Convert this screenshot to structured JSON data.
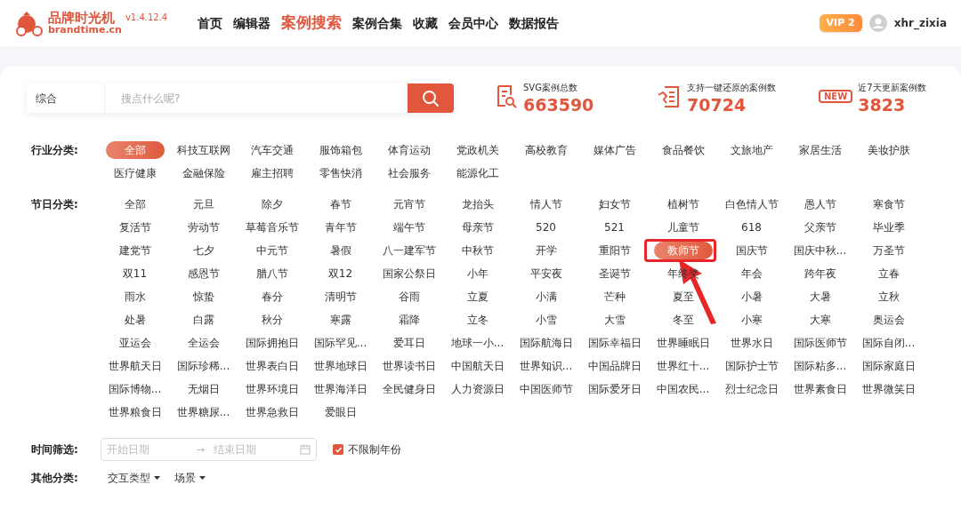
{
  "header": {
    "logo": {
      "name": "品牌时光机",
      "domain": "brandtime.cn"
    },
    "version": "v1.4.12.4",
    "nav": [
      {
        "label": "首页",
        "selected": false
      },
      {
        "label": "编辑器",
        "selected": false
      },
      {
        "label": "案例搜索",
        "selected": true
      },
      {
        "label": "案例合集",
        "selected": false
      },
      {
        "label": "收藏",
        "selected": false
      },
      {
        "label": "会员中心",
        "selected": false
      },
      {
        "label": "数据报告",
        "selected": false
      }
    ],
    "vip_badge": "VIP 2",
    "username": "xhr_zixia"
  },
  "search": {
    "scope": "综合",
    "placeholder": "搜点什么呢?"
  },
  "stats": [
    {
      "kind": "doc",
      "label": "SVG案例总数",
      "value": "663590"
    },
    {
      "kind": "restore",
      "label": "支持一键还原的案例数",
      "value": "70724"
    },
    {
      "kind": "new",
      "label": "近7天更新案例数",
      "value": "3823",
      "icon_text": "NEW"
    }
  ],
  "industry": {
    "label": "行业分类:",
    "items": [
      {
        "label": "全部",
        "selected": true
      },
      {
        "label": "科技互联网",
        "selected": false
      },
      {
        "label": "汽车交通",
        "selected": false
      },
      {
        "label": "服饰箱包",
        "selected": false
      },
      {
        "label": "体育运动",
        "selected": false
      },
      {
        "label": "党政机关",
        "selected": false
      },
      {
        "label": "高校教育",
        "selected": false
      },
      {
        "label": "媒体广告",
        "selected": false
      },
      {
        "label": "食品餐饮",
        "selected": false
      },
      {
        "label": "文旅地产",
        "selected": false
      },
      {
        "label": "家居生活",
        "selected": false
      },
      {
        "label": "美妆护肤",
        "selected": false
      },
      {
        "label": "医疗健康",
        "selected": false
      },
      {
        "label": "金融保险",
        "selected": false
      },
      {
        "label": "雇主招聘",
        "selected": false
      },
      {
        "label": "零售快消",
        "selected": false
      },
      {
        "label": "社会服务",
        "selected": false
      },
      {
        "label": "能源化工",
        "selected": false
      }
    ]
  },
  "festival": {
    "label": "节日分类:",
    "items": [
      {
        "label": "全部",
        "selected": false
      },
      {
        "label": "元旦",
        "selected": false
      },
      {
        "label": "除夕",
        "selected": false
      },
      {
        "label": "春节",
        "selected": false
      },
      {
        "label": "元宵节",
        "selected": false
      },
      {
        "label": "龙抬头",
        "selected": false
      },
      {
        "label": "情人节",
        "selected": false
      },
      {
        "label": "妇女节",
        "selected": false
      },
      {
        "label": "植树节",
        "selected": false
      },
      {
        "label": "白色情人节",
        "selected": false
      },
      {
        "label": "愚人节",
        "selected": false
      },
      {
        "label": "寒食节",
        "selected": false
      },
      {
        "label": "复活节",
        "selected": false
      },
      {
        "label": "劳动节",
        "selected": false
      },
      {
        "label": "草莓音乐节",
        "selected": false
      },
      {
        "label": "青年节",
        "selected": false
      },
      {
        "label": "端午节",
        "selected": false
      },
      {
        "label": "母亲节",
        "selected": false
      },
      {
        "label": "520",
        "selected": false
      },
      {
        "label": "521",
        "selected": false
      },
      {
        "label": "儿童节",
        "selected": false
      },
      {
        "label": "618",
        "selected": false
      },
      {
        "label": "父亲节",
        "selected": false
      },
      {
        "label": "毕业季",
        "selected": false
      },
      {
        "label": "建党节",
        "selected": false
      },
      {
        "label": "七夕",
        "selected": false
      },
      {
        "label": "中元节",
        "selected": false
      },
      {
        "label": "暑假",
        "selected": false
      },
      {
        "label": "八一建军节",
        "selected": false
      },
      {
        "label": "中秋节",
        "selected": false
      },
      {
        "label": "开学",
        "selected": false
      },
      {
        "label": "重阳节",
        "selected": false
      },
      {
        "label": "教师节",
        "selected": true
      },
      {
        "label": "国庆节",
        "selected": false
      },
      {
        "label": "国庆中秋...",
        "selected": false
      },
      {
        "label": "万圣节",
        "selected": false
      },
      {
        "label": "双11",
        "selected": false
      },
      {
        "label": "感恩节",
        "selected": false
      },
      {
        "label": "腊八节",
        "selected": false
      },
      {
        "label": "双12",
        "selected": false
      },
      {
        "label": "国家公祭日",
        "selected": false
      },
      {
        "label": "小年",
        "selected": false
      },
      {
        "label": "平安夜",
        "selected": false
      },
      {
        "label": "圣诞节",
        "selected": false
      },
      {
        "label": "年终奖",
        "selected": false
      },
      {
        "label": "年会",
        "selected": false
      },
      {
        "label": "跨年夜",
        "selected": false
      },
      {
        "label": "立春",
        "selected": false
      },
      {
        "label": "雨水",
        "selected": false
      },
      {
        "label": "惊蛰",
        "selected": false
      },
      {
        "label": "春分",
        "selected": false
      },
      {
        "label": "清明节",
        "selected": false
      },
      {
        "label": "谷雨",
        "selected": false
      },
      {
        "label": "立夏",
        "selected": false
      },
      {
        "label": "小满",
        "selected": false
      },
      {
        "label": "芒种",
        "selected": false
      },
      {
        "label": "夏至",
        "selected": false
      },
      {
        "label": "小暑",
        "selected": false
      },
      {
        "label": "大暑",
        "selected": false
      },
      {
        "label": "立秋",
        "selected": false
      },
      {
        "label": "处暑",
        "selected": false
      },
      {
        "label": "白露",
        "selected": false
      },
      {
        "label": "秋分",
        "selected": false
      },
      {
        "label": "寒露",
        "selected": false
      },
      {
        "label": "霜降",
        "selected": false
      },
      {
        "label": "立冬",
        "selected": false
      },
      {
        "label": "小雪",
        "selected": false
      },
      {
        "label": "大雪",
        "selected": false
      },
      {
        "label": "冬至",
        "selected": false
      },
      {
        "label": "小寒",
        "selected": false
      },
      {
        "label": "大寒",
        "selected": false
      },
      {
        "label": "奥运会",
        "selected": false
      },
      {
        "label": "亚运会",
        "selected": false
      },
      {
        "label": "全运会",
        "selected": false
      },
      {
        "label": "国际拥抱日",
        "selected": false
      },
      {
        "label": "国际罕见...",
        "selected": false
      },
      {
        "label": "爱耳日",
        "selected": false
      },
      {
        "label": "地球一小...",
        "selected": false
      },
      {
        "label": "国际航海日",
        "selected": false
      },
      {
        "label": "国际幸福日",
        "selected": false
      },
      {
        "label": "世界睡眠日",
        "selected": false
      },
      {
        "label": "世界水日",
        "selected": false
      },
      {
        "label": "国际医师节",
        "selected": false
      },
      {
        "label": "国际自闭...",
        "selected": false
      },
      {
        "label": "世界航天日",
        "selected": false
      },
      {
        "label": "国际珍稀...",
        "selected": false
      },
      {
        "label": "世界表白日",
        "selected": false
      },
      {
        "label": "世界地球日",
        "selected": false
      },
      {
        "label": "世界读书日",
        "selected": false
      },
      {
        "label": "中国航天日",
        "selected": false
      },
      {
        "label": "世界知识...",
        "selected": false
      },
      {
        "label": "中国品牌日",
        "selected": false
      },
      {
        "label": "世界红十...",
        "selected": false
      },
      {
        "label": "国际护士节",
        "selected": false
      },
      {
        "label": "国际粘多...",
        "selected": false
      },
      {
        "label": "国际家庭日",
        "selected": false
      },
      {
        "label": "国际博物...",
        "selected": false
      },
      {
        "label": "无烟日",
        "selected": false
      },
      {
        "label": "世界环境日",
        "selected": false
      },
      {
        "label": "世界海洋日",
        "selected": false
      },
      {
        "label": "全民健身日",
        "selected": false
      },
      {
        "label": "人力资源日",
        "selected": false
      },
      {
        "label": "中国医师节",
        "selected": false
      },
      {
        "label": "国际爱牙日",
        "selected": false
      },
      {
        "label": "中国农民...",
        "selected": false
      },
      {
        "label": "烈士纪念日",
        "selected": false
      },
      {
        "label": "世界素食日",
        "selected": false
      },
      {
        "label": "世界微笑日",
        "selected": false
      },
      {
        "label": "世界粮食日",
        "selected": false
      },
      {
        "label": "世界糖尿...",
        "selected": false
      },
      {
        "label": "世界急救日",
        "selected": false
      },
      {
        "label": "爱眼日",
        "selected": false
      }
    ]
  },
  "time_filter": {
    "label": "时间筛选:",
    "start_placeholder": "开始日期",
    "arrow": "→",
    "end_placeholder": "结束日期",
    "unlimited_year": {
      "label": "不限制年份",
      "checked": true
    }
  },
  "other": {
    "label": "其他分类:",
    "dropdowns": [
      "交互类型",
      "场景"
    ]
  }
}
